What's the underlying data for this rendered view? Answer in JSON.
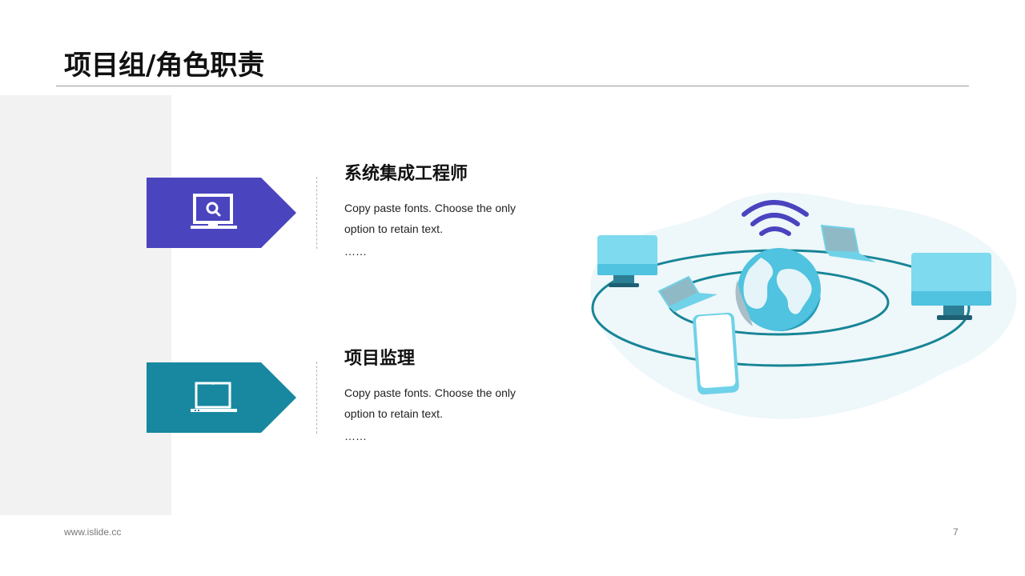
{
  "slide": {
    "title": "项目组/角色职责"
  },
  "roles": [
    {
      "title": "系统集成工程师",
      "body": "Copy paste fonts. Choose the only option to retain text.",
      "ellipsis": "……",
      "icon": "monitor-search-icon",
      "color": "#4a44bf"
    },
    {
      "title": "项目监理",
      "body": "Copy paste fonts. Choose the only option to retain text.",
      "ellipsis": "……",
      "icon": "laptop-icon",
      "color": "#1888a0"
    }
  ],
  "illustration": {
    "icons": [
      "wifi-icon",
      "globe-icon",
      "desktop-monitor-icon",
      "laptop-icon",
      "smartphone-icon"
    ],
    "colors": {
      "blob": "#eef7fa",
      "orbit": "#178596",
      "screen": "#6fd2e8",
      "wifi": "#4a44bf"
    }
  },
  "footer": {
    "url": "www.islide.cc",
    "page": "7"
  }
}
